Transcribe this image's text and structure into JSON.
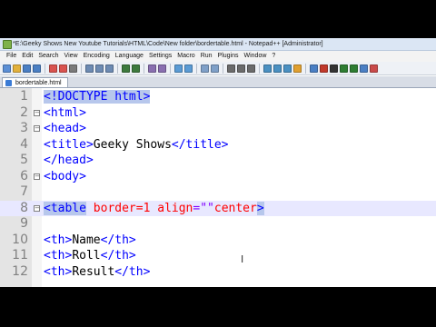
{
  "window": {
    "title": "*E:\\Geeky Shows New Youtube Tutorials\\HTML\\Code\\New folder\\bordertable.html - Notepad++ [Administrator]"
  },
  "menu": {
    "items": [
      "File",
      "Edit",
      "Search",
      "View",
      "Encoding",
      "Language",
      "Settings",
      "Macro",
      "Run",
      "Plugins",
      "Window",
      "?"
    ]
  },
  "tabs": [
    {
      "label": "bordertable.html"
    }
  ],
  "editor": {
    "lines": [
      {
        "num": "1",
        "segments": [
          {
            "t": "<!DOCTYPE html>",
            "c": "tag hl"
          }
        ]
      },
      {
        "num": "2",
        "segments": [
          {
            "t": "<html>",
            "c": "tag"
          }
        ]
      },
      {
        "num": "3",
        "segments": [
          {
            "t": "<head>",
            "c": "tag"
          }
        ]
      },
      {
        "num": "4",
        "segments": [
          {
            "t": "<title>",
            "c": "tag"
          },
          {
            "t": "Geeky Shows",
            "c": "txt"
          },
          {
            "t": "</title>",
            "c": "tag"
          }
        ]
      },
      {
        "num": "5",
        "segments": [
          {
            "t": "</head>",
            "c": "tag"
          }
        ]
      },
      {
        "num": "6",
        "segments": [
          {
            "t": "<body>",
            "c": "tag"
          }
        ]
      },
      {
        "num": "7",
        "segments": []
      },
      {
        "num": "8",
        "segments": [
          {
            "t": "<table",
            "c": "tag hl"
          },
          {
            "t": " ",
            "c": "txt"
          },
          {
            "t": "border",
            "c": "attr"
          },
          {
            "t": "=1 ",
            "c": "attr"
          },
          {
            "t": "align",
            "c": "attr"
          },
          {
            "t": "=\"\"",
            "c": "val"
          },
          {
            "t": "center",
            "c": "attr"
          },
          {
            "t": ">",
            "c": "tag hl"
          }
        ]
      },
      {
        "num": "9",
        "segments": []
      },
      {
        "num": "10",
        "segments": [
          {
            "t": "<th>",
            "c": "tag"
          },
          {
            "t": "Name",
            "c": "txt"
          },
          {
            "t": "</th>",
            "c": "tag"
          }
        ]
      },
      {
        "num": "11",
        "segments": [
          {
            "t": "<th>",
            "c": "tag"
          },
          {
            "t": "Roll",
            "c": "txt"
          },
          {
            "t": "</th>",
            "c": "tag"
          }
        ]
      },
      {
        "num": "12",
        "segments": [
          {
            "t": "<th>",
            "c": "tag"
          },
          {
            "t": "Result",
            "c": "txt"
          },
          {
            "t": "</th>",
            "c": "tag"
          }
        ]
      }
    ],
    "current_line": "8",
    "fold_lines": [
      "2",
      "3",
      "6",
      "8"
    ]
  },
  "colors": {
    "tag": "#0000ff",
    "attribute": "#ff0000",
    "value": "#8000ff",
    "current_line": "#e8e8ff",
    "match_highlight": "#b7c7ec"
  },
  "toolbar_icons": [
    "new-icon",
    "open-icon",
    "save-icon",
    "save-all-icon",
    "close-icon",
    "close-all-icon",
    "print-icon",
    "cut-icon",
    "copy-icon",
    "paste-icon",
    "undo-icon",
    "redo-icon",
    "find-icon",
    "replace-icon",
    "zoom-in-icon",
    "zoom-out-icon",
    "sync-v-icon",
    "sync-h-icon",
    "wrap-icon",
    "all-chars-icon",
    "indent-guide-icon",
    "lang-icon",
    "doc-map-icon",
    "func-list-icon",
    "folder-workspace-icon",
    "monitor-icon",
    "record-macro-icon",
    "stop-record-icon",
    "play-macro-icon",
    "play-multiple-icon",
    "save-macro-icon",
    "spellcheck-icon"
  ]
}
